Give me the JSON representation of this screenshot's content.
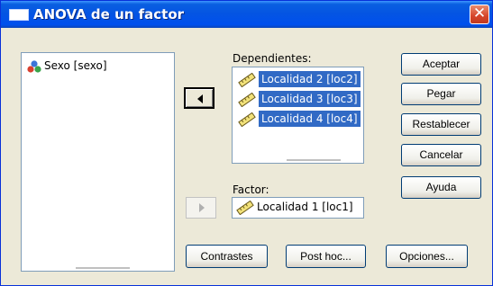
{
  "window": {
    "title": "ANOVA de un factor",
    "close_glyph": "✕"
  },
  "source_list": {
    "items": [
      {
        "label": "Sexo [sexo]",
        "icon": "nominal-variable-icon"
      }
    ]
  },
  "dependents": {
    "label": "Dependientes:",
    "items": [
      {
        "label": "Localidad 2 [loc2]",
        "icon": "scale-variable-icon",
        "selected": true
      },
      {
        "label": "Localidad 3 [loc3]",
        "icon": "scale-variable-icon",
        "selected": true
      },
      {
        "label": "Localidad 4 [loc4]",
        "icon": "scale-variable-icon",
        "selected": true
      }
    ]
  },
  "factor": {
    "label": "Factor:",
    "value": "Localidad 1 [loc1]",
    "icon": "scale-variable-icon"
  },
  "right_buttons": {
    "aceptar": "Aceptar",
    "pegar": "Pegar",
    "restablecer": "Restablecer",
    "cancelar": "Cancelar",
    "ayuda": "Ayuda"
  },
  "bottom_buttons": {
    "contrastes": "Contrastes",
    "post_hoc": "Post hoc...",
    "opciones": "Opciones..."
  },
  "colors": {
    "selection": "#316ac5",
    "titlebar": "#0454e3",
    "dialog_bg": "#ece9d8"
  }
}
